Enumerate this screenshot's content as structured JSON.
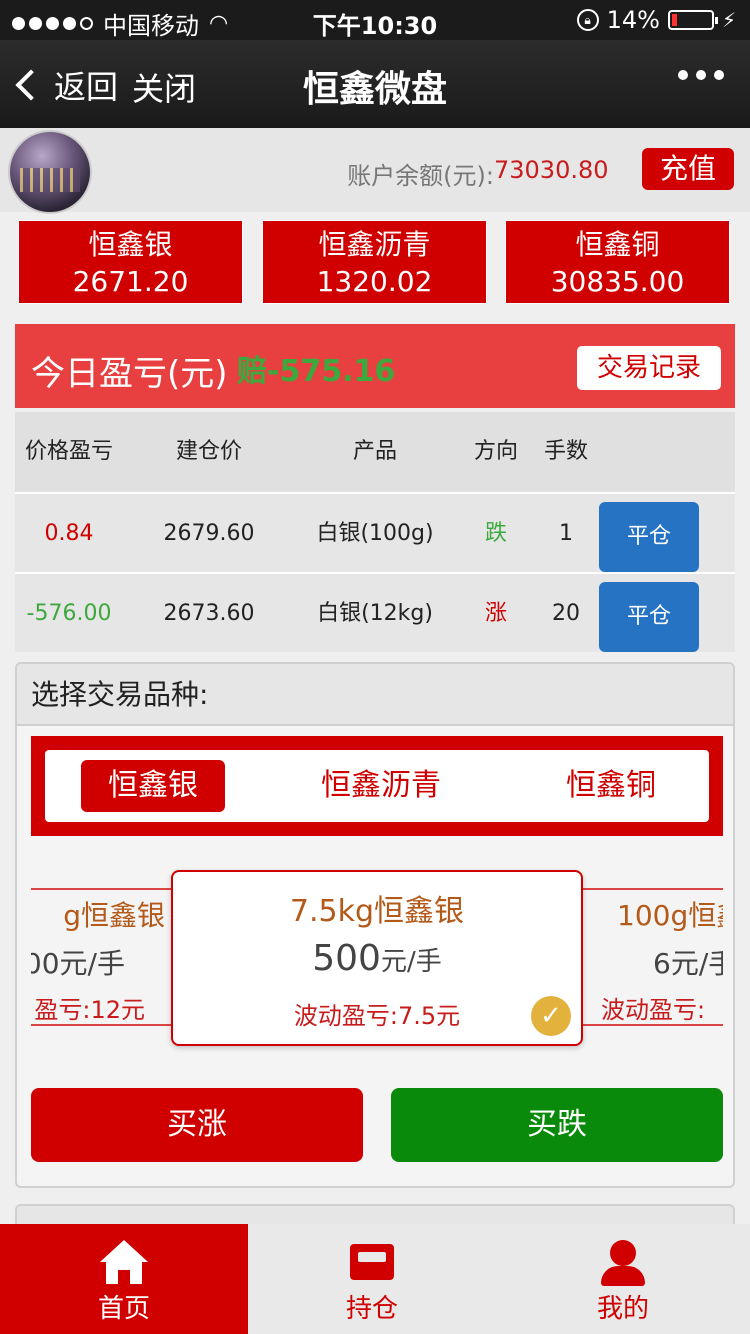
{
  "status_bar": {
    "carrier": "中国移动",
    "time": "下午10:30",
    "battery": "14%",
    "battery_level": 0.14
  },
  "nav": {
    "back_label": "返回",
    "close_label": "关闭",
    "title": "恒鑫微盘"
  },
  "account": {
    "balance_label": "账户余额(元):",
    "balance_value": "73030.80",
    "recharge_label": "充值"
  },
  "tiles": [
    {
      "name": "恒鑫银",
      "price": "2671.20"
    },
    {
      "name": "恒鑫沥青",
      "price": "1320.02"
    },
    {
      "name": "恒鑫铜",
      "price": "30835.00"
    }
  ],
  "today": {
    "label": "今日盈亏(元)",
    "loss_prefix": "赔",
    "loss_value": "-575.16",
    "records_button": "交易记录"
  },
  "table": {
    "headers": [
      "价格盈亏",
      "建仓价",
      "产品",
      "方向",
      "手数"
    ],
    "rows": [
      {
        "pnl": "0.84",
        "open_price": "2679.60",
        "product": "白银(100g)",
        "direction": "跌",
        "lots": "1",
        "close": "平仓"
      },
      {
        "pnl": "-576.00",
        "open_price": "2673.60",
        "product": "白银(12kg)",
        "direction": "涨",
        "lots": "20",
        "close": "平仓"
      }
    ]
  },
  "selector": {
    "title": "选择交易品种:",
    "tabs": [
      "恒鑫银",
      "恒鑫沥青",
      "恒鑫铜"
    ],
    "left_card": {
      "name": "g恒鑫银",
      "price": "00元/手",
      "fluct": "盈亏:12元"
    },
    "main_card": {
      "name": "7.5kg恒鑫银",
      "price": "500",
      "unit": "元/手",
      "fluct": "波动盈亏:7.5元"
    },
    "right_card": {
      "name": "100g恒鑫",
      "price": "6元/手",
      "fluct": "波动盈亏:"
    },
    "buy_up": "买涨",
    "buy_down": "买跌"
  },
  "tabbar": {
    "home": "首页",
    "positions": "持仓",
    "mine": "我的"
  },
  "colors": {
    "brand_red": "#d00000",
    "profit_green": "#3da83d",
    "close_blue": "#2673c4",
    "buy_down_green": "#0a8a0a"
  }
}
